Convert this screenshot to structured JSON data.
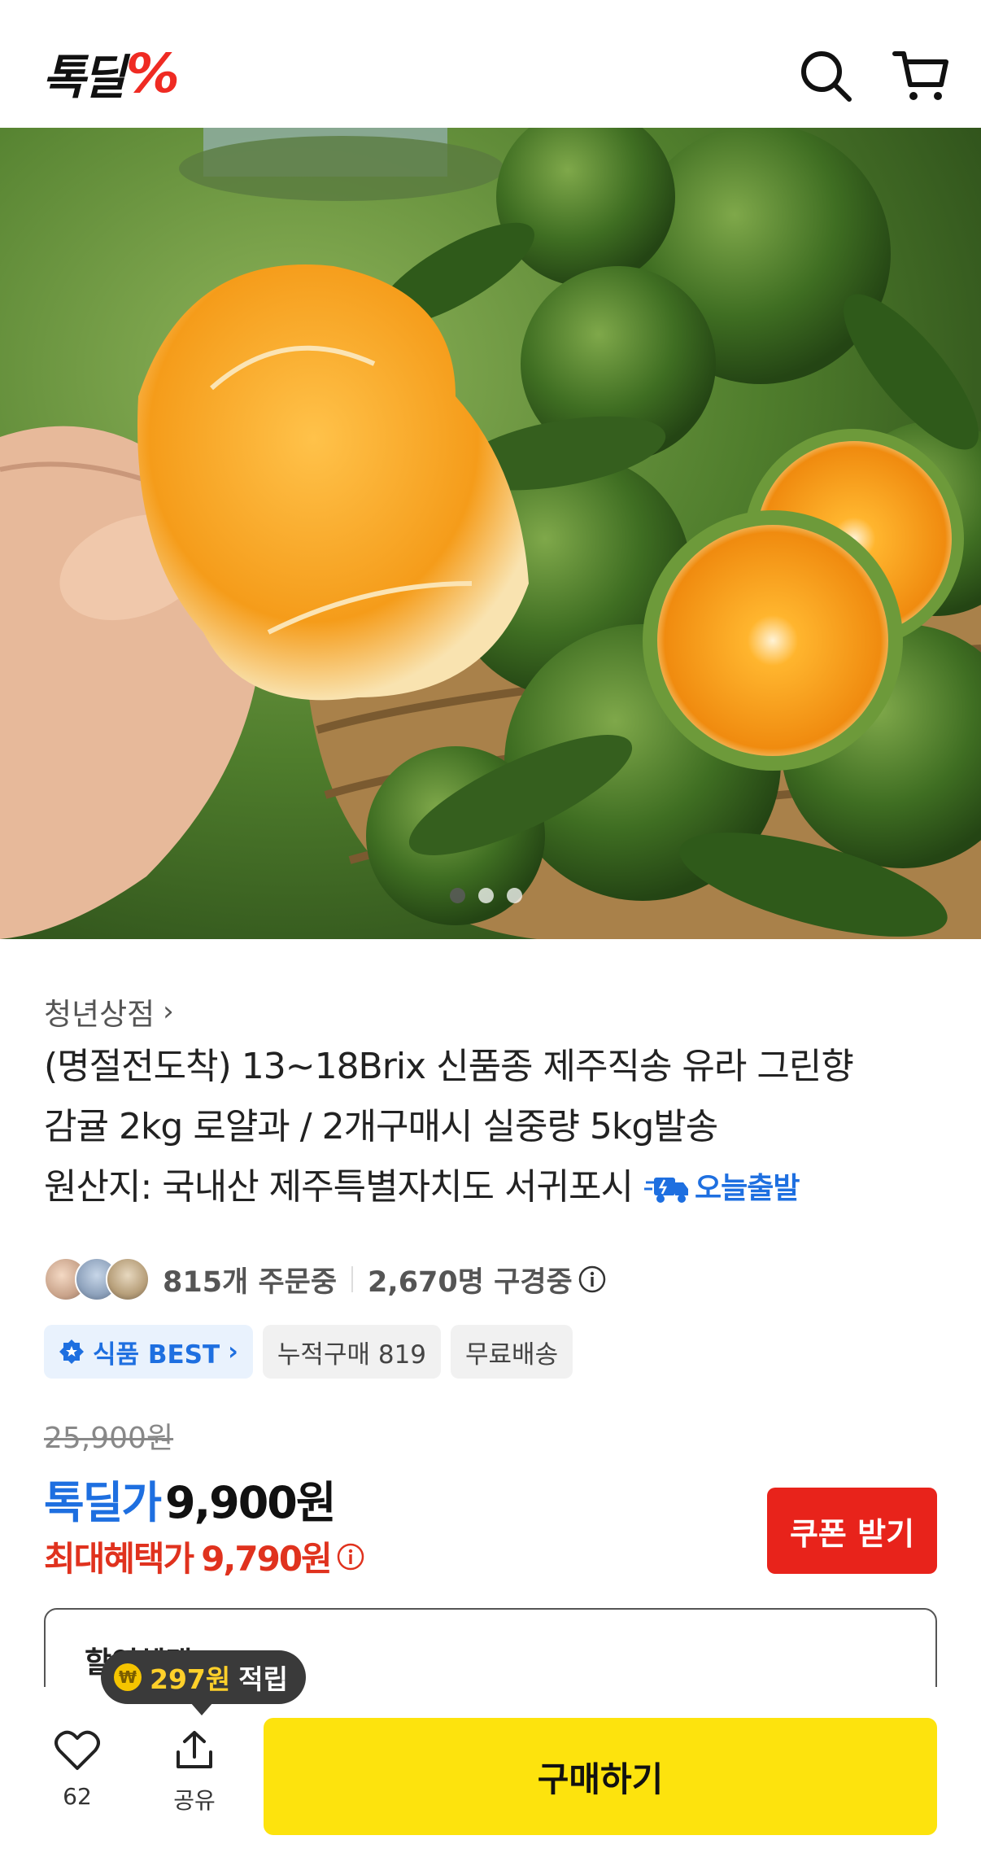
{
  "header": {
    "logo_text": "톡딜",
    "logo_symbol": "%",
    "icons": [
      "search-icon",
      "cart-icon"
    ]
  },
  "hero": {
    "slide_count": 3,
    "active_slide": 1
  },
  "product": {
    "store_name": "청년상점",
    "title_lines": [
      "(명절전도착) 13~18Brix 신품종 제주직송 유라 그린향",
      "감귤 2kg 로얄과 / 2개구매시 실중량 5kg발송",
      "원산지: 국내산 제주특별자치도 서귀포시"
    ],
    "today_badge": "오늘출발",
    "order_count": "815개 주문중",
    "viewer_count": "2,670명 구경중",
    "tags": {
      "best": "식품 BEST",
      "cumulative": "누적구매 819",
      "shipping": "무료배송"
    },
    "original_price": "25,900원",
    "deal_label": "톡딜가",
    "deal_price": "9,900원",
    "max_label": "최대혜택가",
    "max_price": "9,790원",
    "coupon_button": "쿠폰 받기",
    "discount_section_title": "할인혜택"
  },
  "bottom_bar": {
    "likes": "62",
    "share_label": "공유",
    "buy_button": "구매하기",
    "points_amount": "297원",
    "points_text": "적립"
  },
  "colors": {
    "brand_blue": "#1e6fe0",
    "brand_red": "#e8231b",
    "buy_yellow": "#fde30d"
  }
}
